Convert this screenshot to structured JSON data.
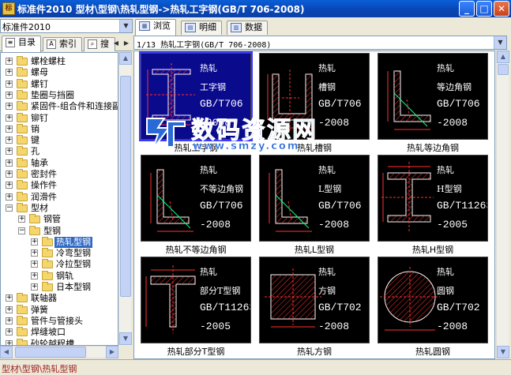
{
  "window": {
    "title": "标准件2010   型材\\型钢\\热轧型钢->热轧工字钢(GB/T 706-2008)",
    "app_icon": "标",
    "minimize": "_",
    "maximize": "□",
    "close": "✕"
  },
  "left_panel": {
    "combo_value": "标准件2010",
    "tabs": [
      "目录",
      "索引",
      "搜"
    ],
    "tree": [
      {
        "label": "螺栓螺柱",
        "level": 0,
        "expander": "+"
      },
      {
        "label": "螺母",
        "level": 0,
        "expander": "+"
      },
      {
        "label": "螺钉",
        "level": 0,
        "expander": "+"
      },
      {
        "label": "垫圈与挡圈",
        "level": 0,
        "expander": "+"
      },
      {
        "label": "紧固件-组合件和连接副",
        "level": 0,
        "expander": "+"
      },
      {
        "label": "铆钉",
        "level": 0,
        "expander": "+"
      },
      {
        "label": "销",
        "level": 0,
        "expander": "+"
      },
      {
        "label": "键",
        "level": 0,
        "expander": "+"
      },
      {
        "label": "孔",
        "level": 0,
        "expander": "+"
      },
      {
        "label": "轴承",
        "level": 0,
        "expander": "+"
      },
      {
        "label": "密封件",
        "level": 0,
        "expander": "+"
      },
      {
        "label": "操作件",
        "level": 0,
        "expander": "+"
      },
      {
        "label": "润滑件",
        "level": 0,
        "expander": "+"
      },
      {
        "label": "型材",
        "level": 0,
        "expander": "−"
      },
      {
        "label": "钢管",
        "level": 1,
        "expander": "+"
      },
      {
        "label": "型钢",
        "level": 1,
        "expander": "−"
      },
      {
        "label": "热轧型钢",
        "level": 2,
        "expander": "+",
        "selected": true
      },
      {
        "label": "冷弯型钢",
        "level": 2,
        "expander": "+"
      },
      {
        "label": "冷拉型钢",
        "level": 2,
        "expander": "+"
      },
      {
        "label": "钢轨",
        "level": 2,
        "expander": "+"
      },
      {
        "label": "日本型钢",
        "level": 2,
        "expander": "+"
      },
      {
        "label": "联轴器",
        "level": 0,
        "expander": "+"
      },
      {
        "label": "弹簧",
        "level": 0,
        "expander": "+"
      },
      {
        "label": "管件与管接头",
        "level": 0,
        "expander": "+"
      },
      {
        "label": "焊缝坡口",
        "level": 0,
        "expander": "+"
      },
      {
        "label": "砂轮越程槽",
        "level": 0,
        "expander": "+"
      }
    ]
  },
  "right_panel": {
    "tabs": [
      "浏览",
      "明细",
      "数据"
    ],
    "tab_icons": [
      "▦",
      "▤",
      "▥"
    ],
    "combo_value": "1/13 热轧工字钢(GB/T 706-2008)",
    "cards": [
      {
        "caption": "热轧工字钢",
        "lines": [
          "热轧",
          "工字钢",
          "GB/T706",
          "-2008"
        ],
        "shape": "i-beam",
        "selected": true
      },
      {
        "caption": "热轧槽钢",
        "lines": [
          "热轧",
          "槽钢",
          "GB/T706",
          "-2008"
        ],
        "shape": "channel"
      },
      {
        "caption": "热轧等边角钢",
        "lines": [
          "热轧",
          "等边角钢",
          "GB/T706",
          "-2008"
        ],
        "shape": "angle"
      },
      {
        "caption": "热轧不等边角钢",
        "lines": [
          "热轧",
          "不等边角钢",
          "GB/T706",
          "-2008"
        ],
        "shape": "angle-unequal"
      },
      {
        "caption": "热轧L型钢",
        "lines": [
          "热轧",
          "L型钢",
          "GB/T706",
          "-2008"
        ],
        "shape": "l-shape"
      },
      {
        "caption": "热轧H型钢",
        "lines": [
          "热轧",
          "H型钢",
          "GB/T11263",
          "-2005"
        ],
        "shape": "h-beam"
      },
      {
        "caption": "热轧部分T型钢",
        "lines": [
          "热轧",
          "部分T型钢",
          "GB/T11263",
          "-2005"
        ],
        "shape": "t-beam"
      },
      {
        "caption": "热轧方钢",
        "lines": [
          "热轧",
          "方钢",
          "GB/T702",
          "-2008"
        ],
        "shape": "square"
      },
      {
        "caption": "热轧圆钢",
        "lines": [
          "热轧",
          "圆钢",
          "GB/T702",
          "-2008"
        ],
        "shape": "round"
      }
    ]
  },
  "status": {
    "path": "型材\\型钢\\热轧型钢"
  },
  "watermark": {
    "text": "数码资源网",
    "url": "www.smzy.com"
  }
}
